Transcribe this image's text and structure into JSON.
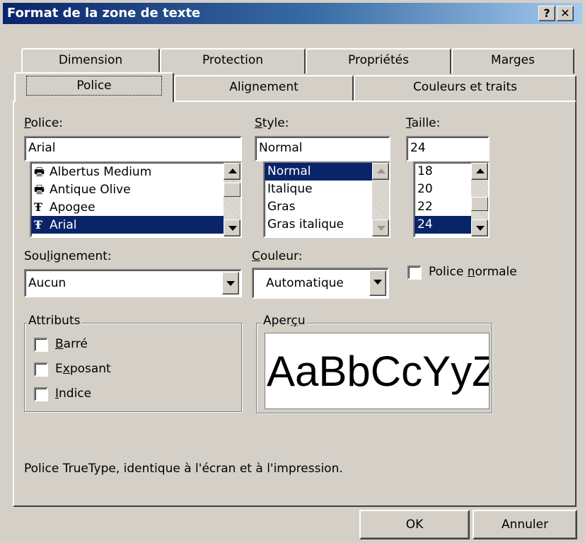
{
  "window": {
    "title": "Format de la zone de texte",
    "help_btn": "?",
    "close_btn": "✕"
  },
  "tabs": {
    "back": [
      "Dimension",
      "Protection",
      "Propriétés",
      "Marges"
    ],
    "front": [
      "Police",
      "Alignement",
      "Couleurs et traits"
    ]
  },
  "font": {
    "label_pre": "",
    "label_u": "P",
    "label_post": "olice:",
    "value": "Arial",
    "items": [
      {
        "icon": "printer-font",
        "name": "Albertus Medium"
      },
      {
        "icon": "printer-font",
        "name": "Antique Olive"
      },
      {
        "icon": "truetype-font",
        "name": "Apogee"
      },
      {
        "icon": "truetype-font",
        "name": "Arial"
      }
    ],
    "selected_index": 3
  },
  "style": {
    "label_pre": "",
    "label_u": "S",
    "label_post": "tyle:",
    "value": "Normal",
    "items": [
      "Normal",
      "Italique",
      "Gras",
      "Gras italique"
    ],
    "selected_index": 0
  },
  "size": {
    "label_pre": "",
    "label_u": "T",
    "label_post": "aille:",
    "value": "24",
    "items": [
      "18",
      "20",
      "22",
      "24"
    ],
    "selected_index": 3
  },
  "underline": {
    "label_pre": "Sou",
    "label_u": "l",
    "label_post": "ignement:",
    "value": "Aucun"
  },
  "color": {
    "label_pre": "",
    "label_u": "C",
    "label_post": "ouleur:",
    "value": "Automatique"
  },
  "normal_font": {
    "label_pre": "Police ",
    "label_u": "n",
    "label_post": "ormale",
    "checked": false
  },
  "attributes": {
    "legend": "Attributs",
    "items": [
      {
        "pre": "",
        "u": "B",
        "post": "arré",
        "checked": false
      },
      {
        "pre": "E",
        "u": "x",
        "post": "posant",
        "checked": false
      },
      {
        "pre": "",
        "u": "I",
        "post": "ndice",
        "checked": false
      }
    ]
  },
  "preview": {
    "legend_pre": "Aper",
    "legend_u": "ç",
    "legend_post": "u",
    "text": "AaBbCcYyZz"
  },
  "status": "Police TrueType, identique à l'écran et à l'impression.",
  "buttons": {
    "ok": "OK",
    "cancel": "Annuler"
  }
}
